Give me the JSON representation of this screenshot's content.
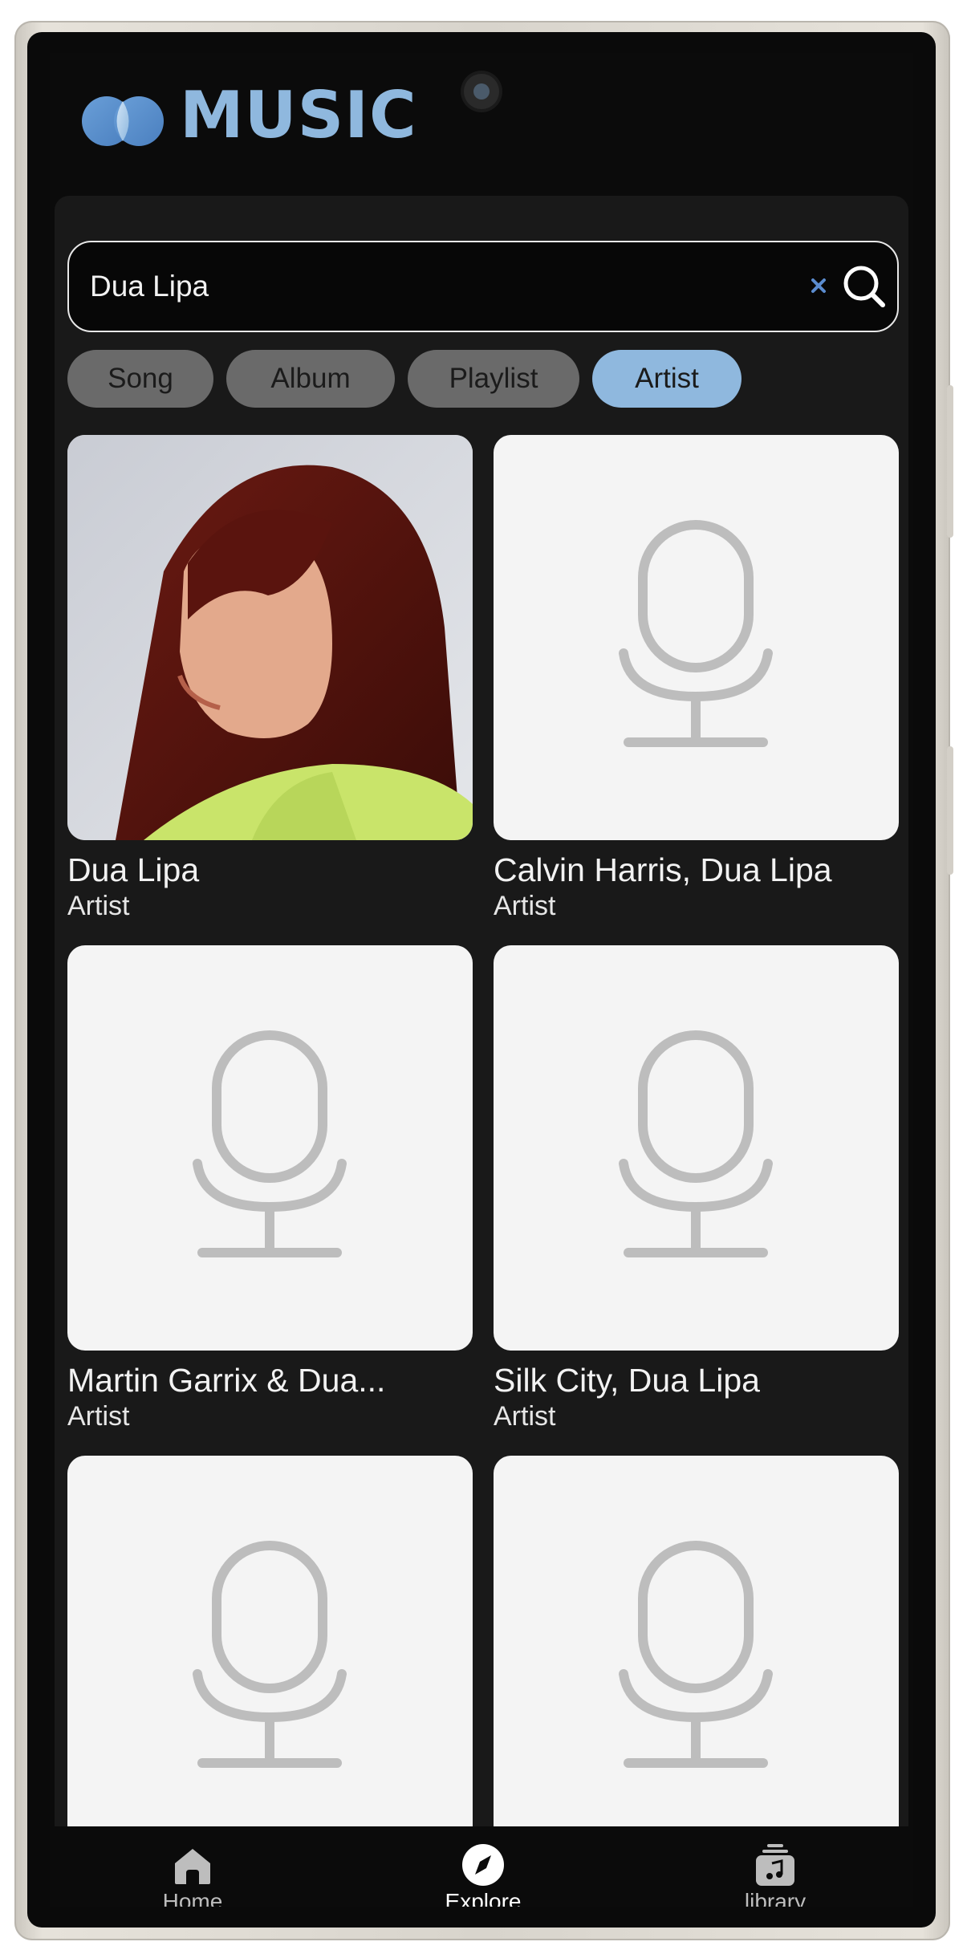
{
  "app": {
    "title": "MUSIC",
    "accent_color": "#8fb8de"
  },
  "search": {
    "value": "Dua Lipa",
    "clear_icon": "close-icon",
    "search_icon": "search-icon"
  },
  "filters": [
    {
      "label": "Song",
      "active": false
    },
    {
      "label": "Album",
      "active": false
    },
    {
      "label": "Playlist",
      "active": false
    },
    {
      "label": "Artist",
      "active": true
    }
  ],
  "results": [
    {
      "name": "Dua Lipa",
      "type": "Artist",
      "image": "artist-photo"
    },
    {
      "name": "Calvin Harris, Dua Lipa",
      "type": "Artist",
      "image": "microphone-placeholder"
    },
    {
      "name": "Martin Garrix & Dua...",
      "type": "Artist",
      "image": "microphone-placeholder"
    },
    {
      "name": "Silk City, Dua Lipa",
      "type": "Artist",
      "image": "microphone-placeholder"
    },
    {
      "name": "",
      "type": "",
      "image": "microphone-placeholder"
    },
    {
      "name": "",
      "type": "",
      "image": "microphone-placeholder"
    }
  ],
  "nav": [
    {
      "label": "Home",
      "icon": "home-icon",
      "active": false
    },
    {
      "label": "Explore",
      "icon": "compass-icon",
      "active": true
    },
    {
      "label": "library",
      "icon": "library-icon",
      "active": false
    }
  ]
}
